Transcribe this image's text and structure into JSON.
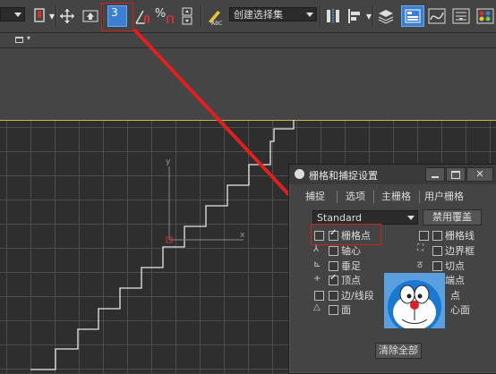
{
  "toolbar": {
    "snaps_label": "3",
    "angle_snap_label": "%",
    "selection_set_value": "创建选择集",
    "accent_color": "#3a7fd0"
  },
  "dialog": {
    "title": "栅格和捕捉设置",
    "tabs": [
      "捕捉",
      "选项",
      "主栅格",
      "用户栅格"
    ],
    "type_value": "Standard",
    "override_button": "禁用覆盖",
    "left_items": [
      {
        "label": "栅格点",
        "checked": true,
        "icon": "grid-points-icon"
      },
      {
        "label": "轴心",
        "checked": false,
        "icon": "pivot-icon"
      },
      {
        "label": "垂足",
        "checked": false,
        "icon": "perpendicular-icon"
      },
      {
        "label": "顶点",
        "checked": true,
        "icon": "vertex-icon"
      },
      {
        "label": "边/线段",
        "checked": false,
        "icon": "edge-icon"
      },
      {
        "label": "面",
        "checked": false,
        "icon": "face-icon"
      }
    ],
    "right_items": [
      {
        "label": "栅格线",
        "checked": false
      },
      {
        "label": "边界框",
        "checked": false
      },
      {
        "label": "切点",
        "checked": false
      },
      {
        "label": "端点",
        "checked": true
      },
      {
        "label": "点",
        "checked": false
      },
      {
        "label": "心面",
        "checked": false
      }
    ],
    "clear_all_button": "清除全部"
  },
  "viewport": {
    "axis_y": "y",
    "axis_x": "x",
    "arrow_color": "#e02020",
    "highlight_color": "#cc2222"
  }
}
